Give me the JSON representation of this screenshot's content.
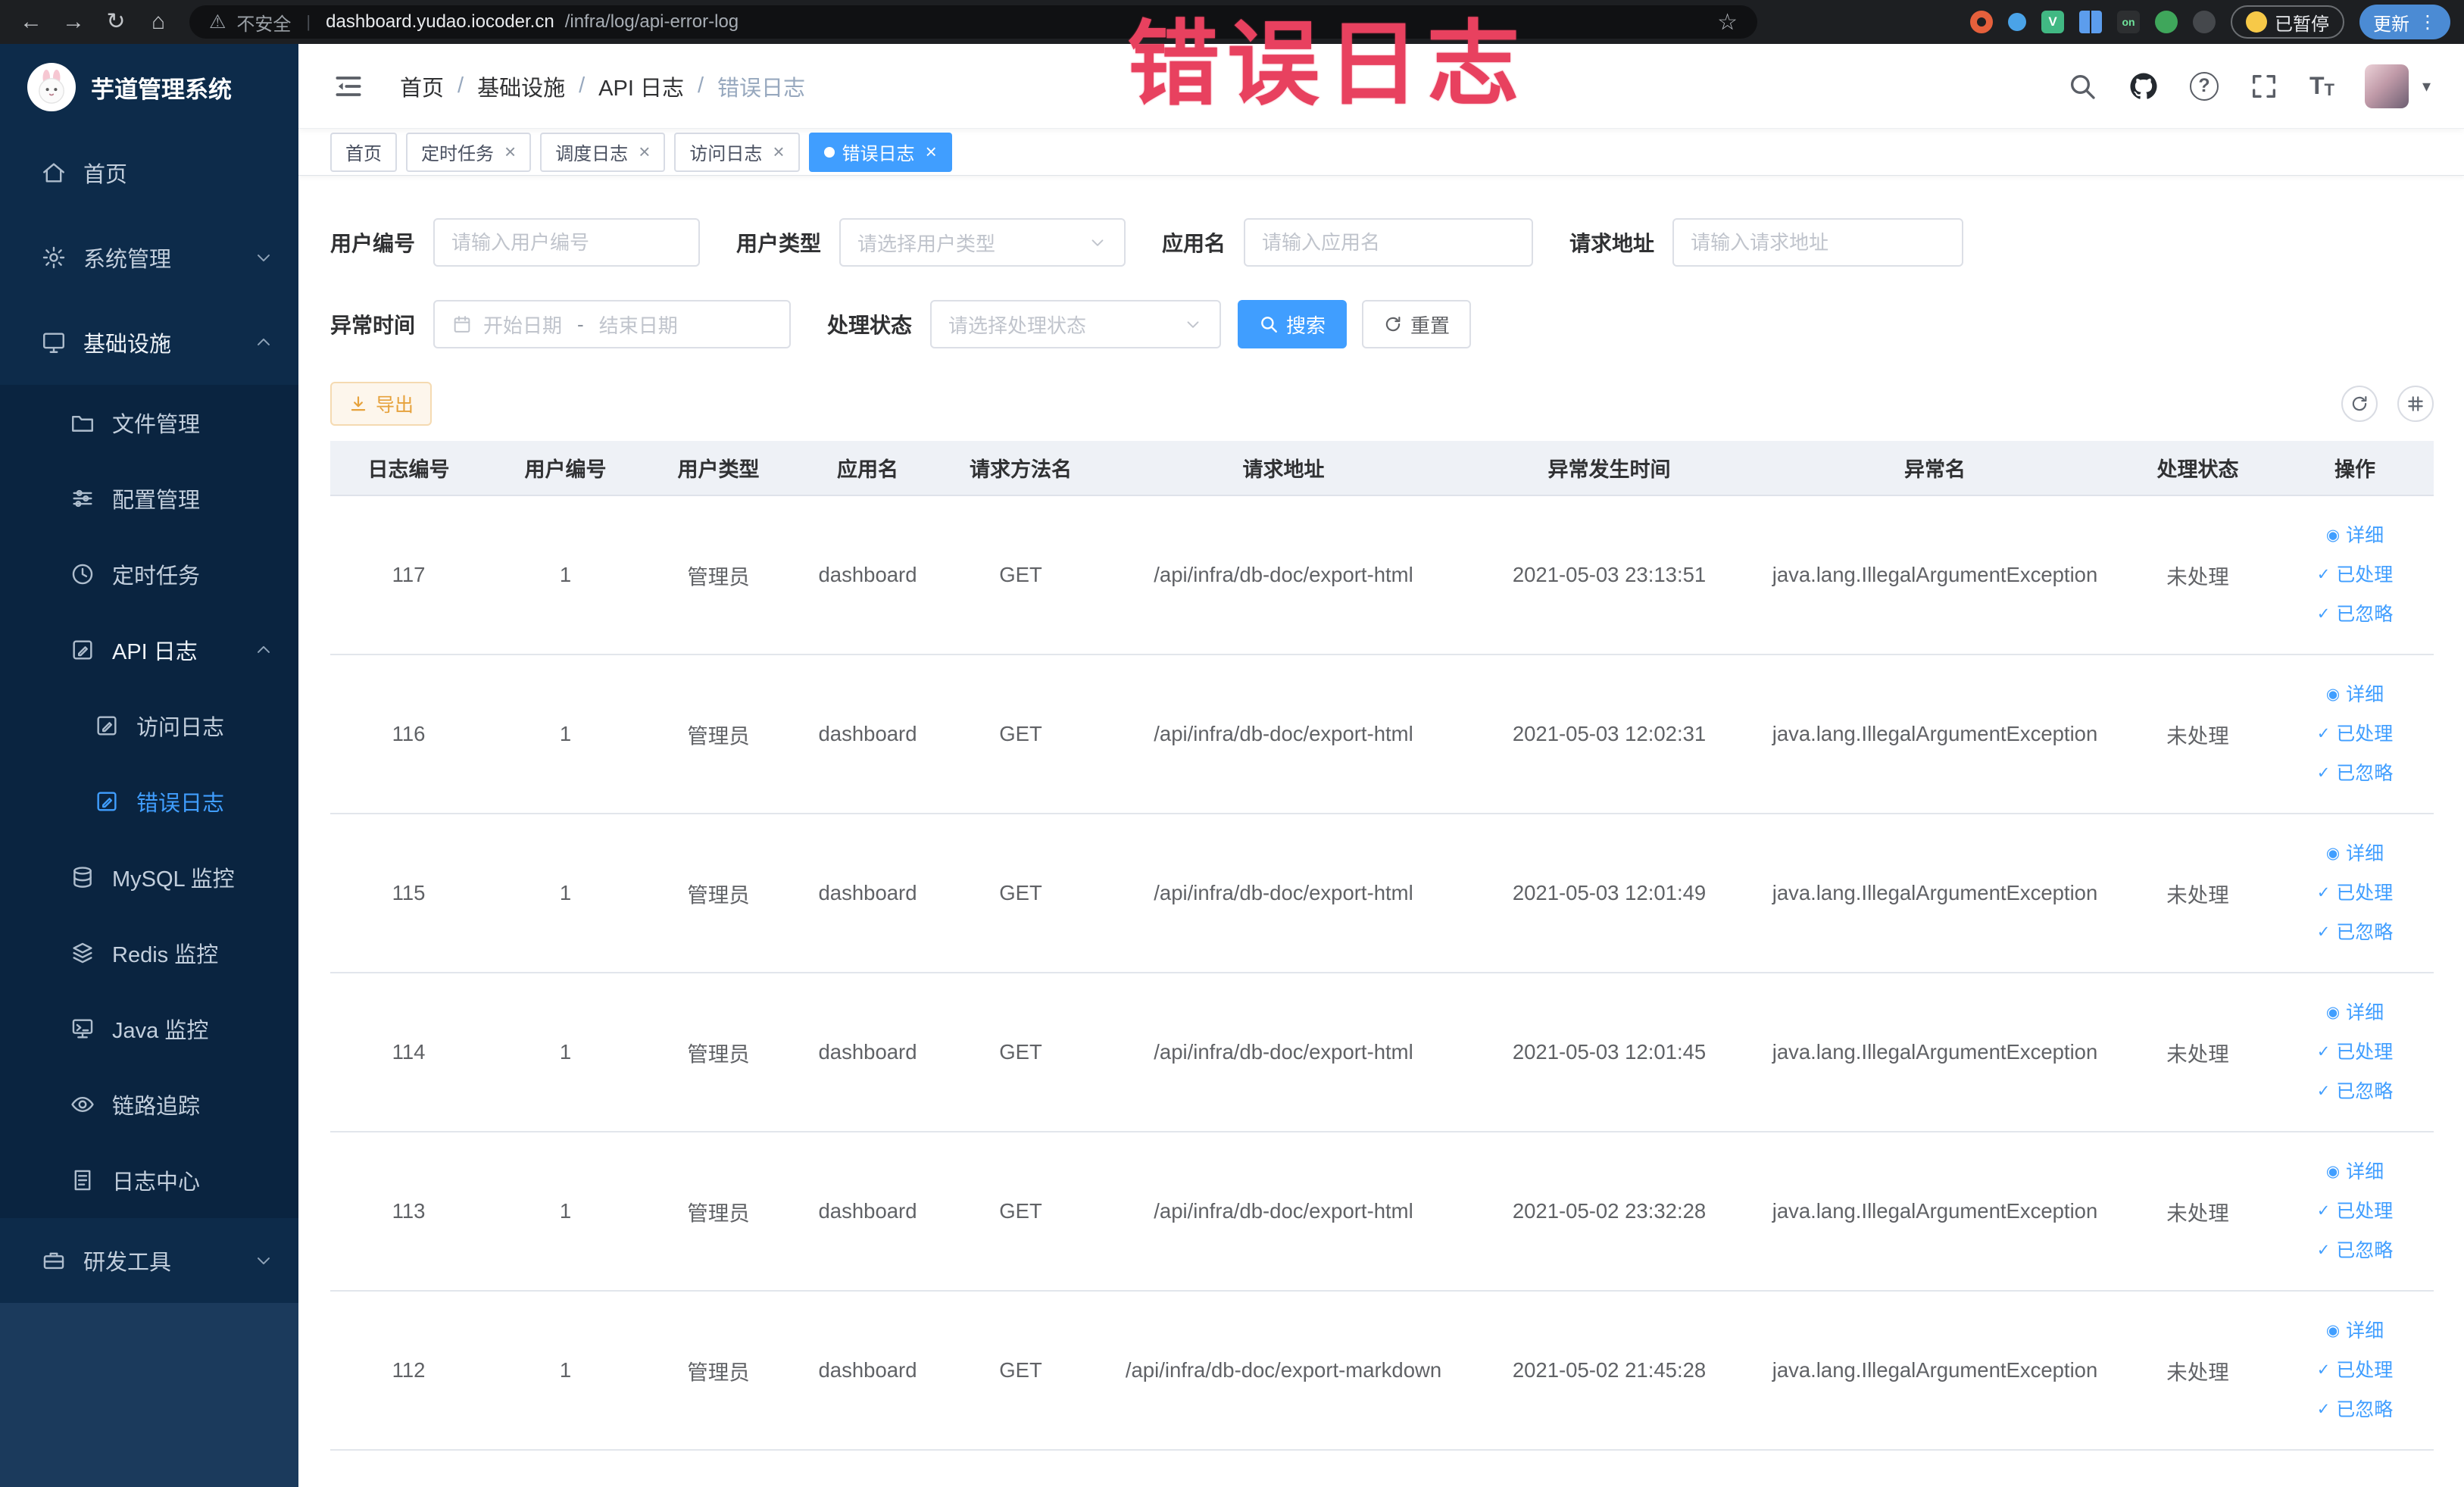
{
  "colors": {
    "primary": "#409eff",
    "warning": "#e6a23c",
    "annotation_red": "#e8415f",
    "sidebar_bg": "#0d2b4a",
    "tag_active_bg": "#409eff"
  },
  "browser": {
    "security_label": "不安全",
    "url_domain": "dashboard.yudao.iocoder.cn",
    "url_path": "/infra/log/api-error-log",
    "paused_badge": "已暂停",
    "update_button": "更新",
    "extension_on_badge": "on"
  },
  "sidebar": {
    "logo_title": "芋道管理系统",
    "items": [
      {
        "label": "首页",
        "icon": "home-icon",
        "level": 1
      },
      {
        "label": "系统管理",
        "icon": "gear-icon",
        "level": 1,
        "expand": "down"
      },
      {
        "label": "基础设施",
        "icon": "monitor-icon",
        "level": 1,
        "expand": "up"
      },
      {
        "label": "文件管理",
        "icon": "folder-icon",
        "level": 2
      },
      {
        "label": "配置管理",
        "icon": "sliders-icon",
        "level": 2
      },
      {
        "label": "定时任务",
        "icon": "clock-icon",
        "level": 2
      },
      {
        "label": "API 日志",
        "icon": "edit-doc-icon",
        "level": 2,
        "expand": "up"
      },
      {
        "label": "访问日志",
        "icon": "edit-doc-icon",
        "level": 3
      },
      {
        "label": "错误日志",
        "icon": "edit-doc-icon",
        "level": 3,
        "active": true
      },
      {
        "label": "MySQL 监控",
        "icon": "database-icon",
        "level": 2
      },
      {
        "label": "Redis 监控",
        "icon": "layers-icon",
        "level": 2
      },
      {
        "label": "Java 监控",
        "icon": "terminal-icon",
        "level": 2
      },
      {
        "label": "链路追踪",
        "icon": "eye-icon",
        "level": 2
      },
      {
        "label": "日志中心",
        "icon": "document-icon",
        "level": 2
      },
      {
        "label": "研发工具",
        "icon": "toolbox-icon",
        "level": 1,
        "expand": "down"
      }
    ]
  },
  "header": {
    "breadcrumb": [
      {
        "label": "首页"
      },
      {
        "label": "基础设施"
      },
      {
        "label": "API 日志"
      },
      {
        "label": "错误日志"
      }
    ],
    "annotation": "错误日志"
  },
  "tabs": [
    {
      "label": "首页",
      "closable": false,
      "active": false
    },
    {
      "label": "定时任务",
      "closable": true,
      "active": false
    },
    {
      "label": "调度日志",
      "closable": true,
      "active": false
    },
    {
      "label": "访问日志",
      "closable": true,
      "active": false
    },
    {
      "label": "错误日志",
      "closable": true,
      "active": true
    }
  ],
  "filters": {
    "user_id": {
      "label": "用户编号",
      "placeholder": "请输入用户编号"
    },
    "user_type": {
      "label": "用户类型",
      "placeholder": "请选择用户类型"
    },
    "app_name": {
      "label": "应用名",
      "placeholder": "请输入应用名"
    },
    "request_url": {
      "label": "请求地址",
      "placeholder": "请输入请求地址"
    },
    "exception_time": {
      "label": "异常时间",
      "start_placeholder": "开始日期",
      "separator": "-",
      "end_placeholder": "结束日期"
    },
    "process_status": {
      "label": "处理状态",
      "placeholder": "请选择处理状态"
    },
    "search_button": "搜索",
    "reset_button": "重置"
  },
  "toolbar": {
    "export_label": "导出"
  },
  "table": {
    "columns": [
      "日志编号",
      "用户编号",
      "用户类型",
      "应用名",
      "请求方法名",
      "请求地址",
      "异常发生时间",
      "异常名",
      "处理状态",
      "操作"
    ],
    "actions": {
      "detail": "详细",
      "processed": "已处理",
      "ignored": "已忽略"
    },
    "rows": [
      {
        "id": "117",
        "user_id": "1",
        "user_type": "管理员",
        "app": "dashboard",
        "method": "GET",
        "url": "/api/infra/db-doc/export-html",
        "time": "2021-05-03 23:13:51",
        "exception": "java.lang.IllegalArgumentException",
        "status": "未处理"
      },
      {
        "id": "116",
        "user_id": "1",
        "user_type": "管理员",
        "app": "dashboard",
        "method": "GET",
        "url": "/api/infra/db-doc/export-html",
        "time": "2021-05-03 12:02:31",
        "exception": "java.lang.IllegalArgumentException",
        "status": "未处理"
      },
      {
        "id": "115",
        "user_id": "1",
        "user_type": "管理员",
        "app": "dashboard",
        "method": "GET",
        "url": "/api/infra/db-doc/export-html",
        "time": "2021-05-03 12:01:49",
        "exception": "java.lang.IllegalArgumentException",
        "status": "未处理"
      },
      {
        "id": "114",
        "user_id": "1",
        "user_type": "管理员",
        "app": "dashboard",
        "method": "GET",
        "url": "/api/infra/db-doc/export-html",
        "time": "2021-05-03 12:01:45",
        "exception": "java.lang.IllegalArgumentException",
        "status": "未处理"
      },
      {
        "id": "113",
        "user_id": "1",
        "user_type": "管理员",
        "app": "dashboard",
        "method": "GET",
        "url": "/api/infra/db-doc/export-html",
        "time": "2021-05-02 23:32:28",
        "exception": "java.lang.IllegalArgumentException",
        "status": "未处理"
      },
      {
        "id": "112",
        "user_id": "1",
        "user_type": "管理员",
        "app": "dashboard",
        "method": "GET",
        "url": "/api/infra/db-doc/export-markdown",
        "time": "2021-05-02 21:45:28",
        "exception": "java.lang.IllegalArgumentException",
        "status": "未处理"
      }
    ]
  }
}
